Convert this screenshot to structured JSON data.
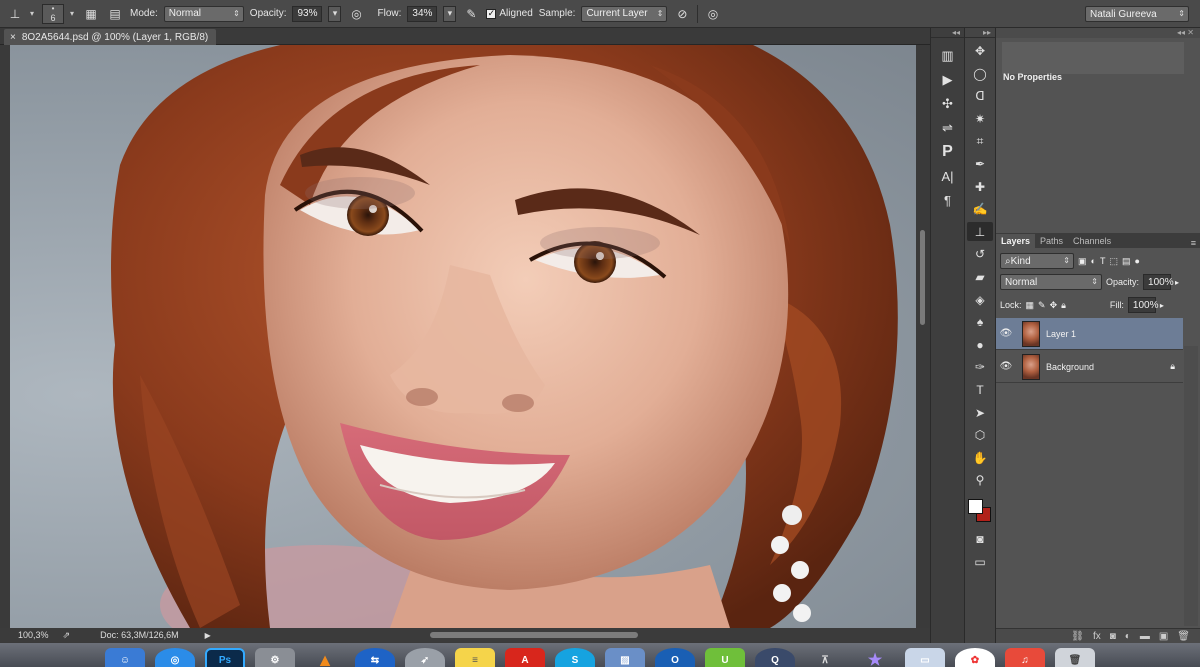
{
  "options_bar": {
    "brush_size": "6",
    "mode_label": "Mode:",
    "mode_value": "Normal",
    "opacity_label": "Opacity:",
    "opacity_value": "93%",
    "flow_label": "Flow:",
    "flow_value": "34%",
    "aligned_label": "Aligned",
    "aligned_checked": true,
    "sample_label": "Sample:",
    "sample_value": "Current Layer",
    "user_name": "Natali Gureeva"
  },
  "document": {
    "tab_title": "8O2A5644.psd @ 100% (Layer 1, RGB/8)",
    "close_glyph": "×"
  },
  "status_bar": {
    "zoom": "100,3%",
    "doc_size": "Doc: 63,3M/126,6M"
  },
  "properties": {
    "title": "No Properties"
  },
  "layers_panel": {
    "tabs": [
      {
        "label": "Layers",
        "active": true
      },
      {
        "label": "Paths",
        "active": false
      },
      {
        "label": "Channels",
        "active": false
      }
    ],
    "filter_label": "Kind",
    "blend_mode": "Normal",
    "opacity_label": "Opacity:",
    "opacity_value": "100%",
    "lock_label": "Lock:",
    "fill_label": "Fill:",
    "fill_value": "100%",
    "layers": [
      {
        "name": "Layer 1",
        "selected": true,
        "locked": false
      },
      {
        "name": "Background",
        "selected": false,
        "locked": true
      }
    ]
  },
  "colors": {
    "foreground": "#ffffff",
    "background": "#b1211a",
    "selection": "#6d7d96"
  },
  "tools": [
    "move-tool",
    "marquee-tool",
    "lasso-tool",
    "magic-wand-tool",
    "crop-tool",
    "eyedropper-tool",
    "healing-brush-tool",
    "brush-tool",
    "clone-stamp-tool",
    "history-brush-tool",
    "eraser-tool",
    "paint-bucket-tool",
    "blur-tool",
    "dodge-tool",
    "pen-tool",
    "type-tool",
    "path-selection-tool",
    "shape-tool",
    "hand-tool",
    "zoom-tool"
  ],
  "strip_icons": [
    "histogram-icon",
    "play-icon",
    "brush-presets-icon",
    "adjustments-icon",
    "paragraph-style-icon",
    "character-icon",
    "paragraph-icon"
  ],
  "dock_apps": [
    "finder",
    "safari",
    "photoshop",
    "system-preferences",
    "vlc",
    "teamviewer",
    "launchpad",
    "notes",
    "acrobat",
    "skype",
    "preview",
    "opera",
    "upwork",
    "quicktime",
    "keynote",
    "itunes",
    "imovie",
    "photos",
    "fantastical",
    "trash"
  ]
}
